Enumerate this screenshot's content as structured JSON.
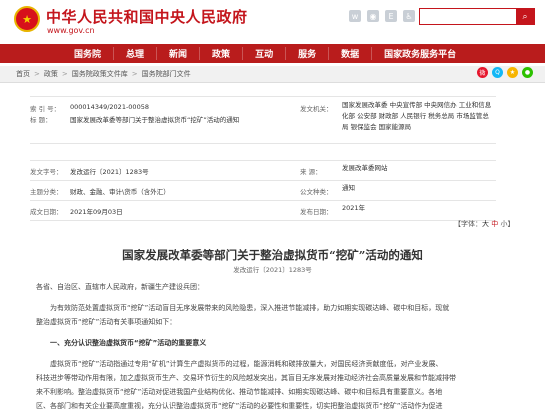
{
  "header": {
    "site_title": "中华人民共和国中央人民政府",
    "site_url": "www.gov.cn",
    "icons": [
      "weibo-icon",
      "wechat-icon",
      "english-icon",
      "accessibility-icon"
    ],
    "search_placeholder": "",
    "search_icon": "search-icon"
  },
  "nav": {
    "items": [
      "国务院",
      "总理",
      "新闻",
      "政策",
      "互动",
      "服务",
      "数据",
      "国家政务服务平台"
    ]
  },
  "breadcrumb": {
    "items": [
      "首页",
      "政策",
      "国务院政策文件库",
      "国务院部门文件"
    ],
    "separator": ">"
  },
  "share_icons": [
    "weibo-share-icon",
    "qq-share-icon",
    "qzone-share-icon",
    "wechat-share-icon"
  ],
  "info": {
    "index_label": "索  引  号：",
    "index_value": "000014349/2021-00058",
    "issuer_label": "发文机关：",
    "issuer_value": "国家发展改革委 中央宣传部 中央网信办 工业和信息化部 公安部 财政部 人民银行 税务总局 市场监管总局 银保监会 国家能源局",
    "title_label": "标      题：",
    "title_value": "国家发展改革委等部门关于整治虚拟货币“挖矿”活动的通知",
    "doc_no_label": "发文字号：",
    "doc_no_value": "发改运行〔2021〕1283号",
    "source_label": "来      源：",
    "source_value": "发展改革委网站",
    "category_label": "主题分类：",
    "category_value": "财政、金融、审计\\货币（含外汇）",
    "type_label": "公文种类：",
    "type_value": "通知",
    "date_label": "成文日期：",
    "date_value": "2021年09月03日",
    "publish_label": "发布日期：",
    "publish_value": "2021年"
  },
  "font_size": {
    "label": "【字体：",
    "large": "大",
    "medium": "中",
    "small": "小",
    "close": "】"
  },
  "document": {
    "title": "国家发展改革委等部门关于整治虚拟货币“挖矿”活动的通知",
    "number": "发改运行〔2021〕1283号",
    "addressee": "各省、自治区、直辖市人民政府，新疆生产建设兵团：",
    "para1_line1": "为有效防范处置虚拟货币“挖矿”活动盲目无序发展带来的风险隐患，深入推进节能减排，助力如期实现碳达峰、碳中和目标，现就",
    "para1_line2": "整治虚拟货币“挖矿”活动有关事项通知如下：",
    "section1_title": "一、充分认识整治虚拟货币“挖矿”活动的重要意义",
    "para2_line1": "虚拟货币“挖矿”活动指通过专用“矿机”计算生产虚拟货币的过程，能源消耗和碳排放量大，对国民经济贡献度低，对产业发展、",
    "para2_line2": "科技进步等带动作用有限，加之虚拟货币生产、交易环节衍生的风险越发突出，其盲目无序发展对推动经济社会高质量发展和节能减排带",
    "para2_line3": "来不利影响。整治虚拟货币“挖矿”活动对促进我国产业结构优化、推动节能减排、如期实现碳达峰、碳中和目标具有重要意义。各地",
    "para2_line4": "区、各部门和有关企业要高度重视，充分认识整治虚拟货币“挖矿”活动的必要性和重要性，切实把整治虚拟货币“挖矿”活动作为促进"
  }
}
